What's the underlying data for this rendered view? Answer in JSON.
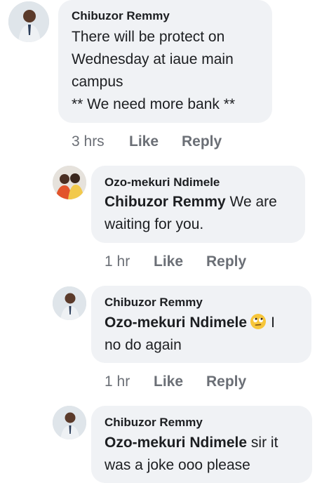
{
  "comments": [
    {
      "author": "Chibuzor Remmy",
      "lines": [
        "There will be protect on",
        "Wednesday at iaue main",
        "campus",
        "** We need more bank **"
      ],
      "time": "3 hrs",
      "like_label": "Like",
      "reply_label": "Reply"
    }
  ],
  "replies": [
    {
      "author": "Ozo-mekuri Ndimele",
      "mention": "Chibuzor Remmy",
      "line1_rest": "We are",
      "line2": "waiting for you.",
      "time": "1 hr",
      "like_label": "Like",
      "reply_label": "Reply"
    },
    {
      "author": "Chibuzor Remmy",
      "mention": "Ozo-mekuri Ndimele",
      "emoji": "rolling-eyes-emoji",
      "line1_rest": "I",
      "line2": "no do again",
      "time": "1 hr",
      "like_label": "Like",
      "reply_label": "Reply"
    },
    {
      "author": "Chibuzor Remmy",
      "mention": "Ozo-mekuri Ndimele",
      "line1_rest": "sir it",
      "line2": "was a joke ooo please"
    }
  ],
  "colors": {
    "bubble": "#f0f2f5",
    "text": "#1c1e21",
    "meta": "#6b6f76"
  }
}
